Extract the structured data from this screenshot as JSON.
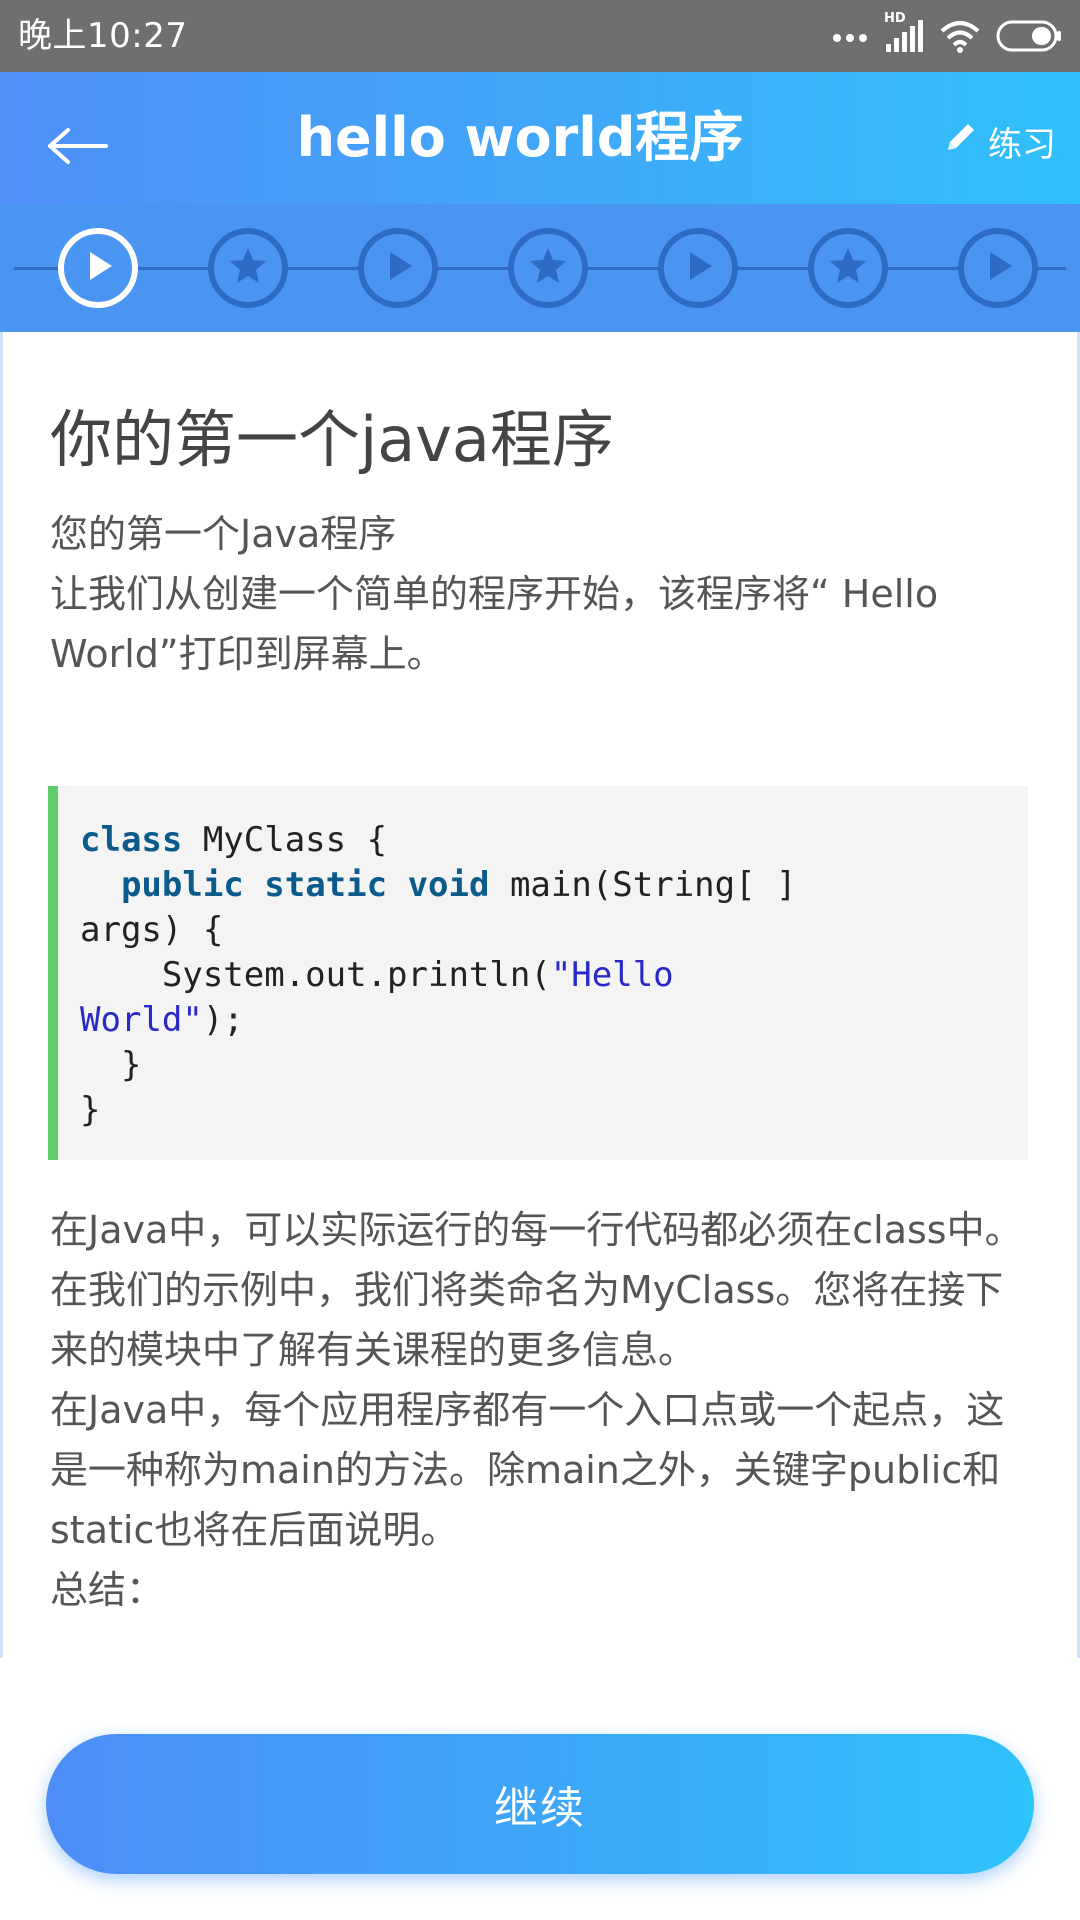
{
  "status_bar": {
    "time": "晚上10:27",
    "network_badge": "HD",
    "icons": [
      "more-dots-icon",
      "signal-icon",
      "wifi-icon",
      "battery-icon"
    ]
  },
  "header": {
    "back_icon": "arrow-left-icon",
    "title": "hello world程序",
    "practice_label": "练习",
    "practice_icon": "pencil-icon",
    "gradient_colors": [
      "#4f8ff7",
      "#31c0fb"
    ]
  },
  "stepper": {
    "steps": [
      {
        "type": "play",
        "icon": "play-icon",
        "active": true
      },
      {
        "type": "star",
        "icon": "star-icon",
        "active": false
      },
      {
        "type": "play",
        "icon": "play-icon",
        "active": false
      },
      {
        "type": "star",
        "icon": "star-icon",
        "active": false
      },
      {
        "type": "play",
        "icon": "play-icon",
        "active": false
      },
      {
        "type": "star",
        "icon": "star-icon",
        "active": false
      },
      {
        "type": "play",
        "icon": "play-icon",
        "active": false
      }
    ],
    "bar_color": "#4a94f2",
    "ring_color": "#2e6bc4",
    "active_ring_color": "#ffffff"
  },
  "lesson": {
    "title": "你的第一个java程序",
    "intro": [
      "您的第一个Java程序",
      "让我们从创建一个简单的程序开始，该程序将“ Hello World”打印到屏幕上。"
    ],
    "code": {
      "accent_color": "#5fcd6b",
      "line1_kw": "class",
      "line1_rest": " MyClass {",
      "line2_indent": "  ",
      "line2_kw1": "public",
      "line2_kw2": "static",
      "line2_kw3": "void",
      "line2_rest": " main(String[ ]",
      "line3": "args) {",
      "line4_code": "    System.out.println(",
      "line4_str": "\"Hello",
      "line5_str": "World\"",
      "line5_rest": ");",
      "line6": "  }",
      "line7": "}"
    },
    "body": [
      "在Java中，可以实际运行的每一行代码都必须在class中。",
      "在我们的示例中，我们将类命名为MyClass。您将在接下来的模块中了解有关课程的更多信息。",
      "在Java中，每个应用程序都有一个入口点或一个起点，这是一种称为main的方法。除main之外，关键字public和static也将在后面说明。",
      "总结："
    ]
  },
  "continue_button": {
    "label": "继续"
  }
}
